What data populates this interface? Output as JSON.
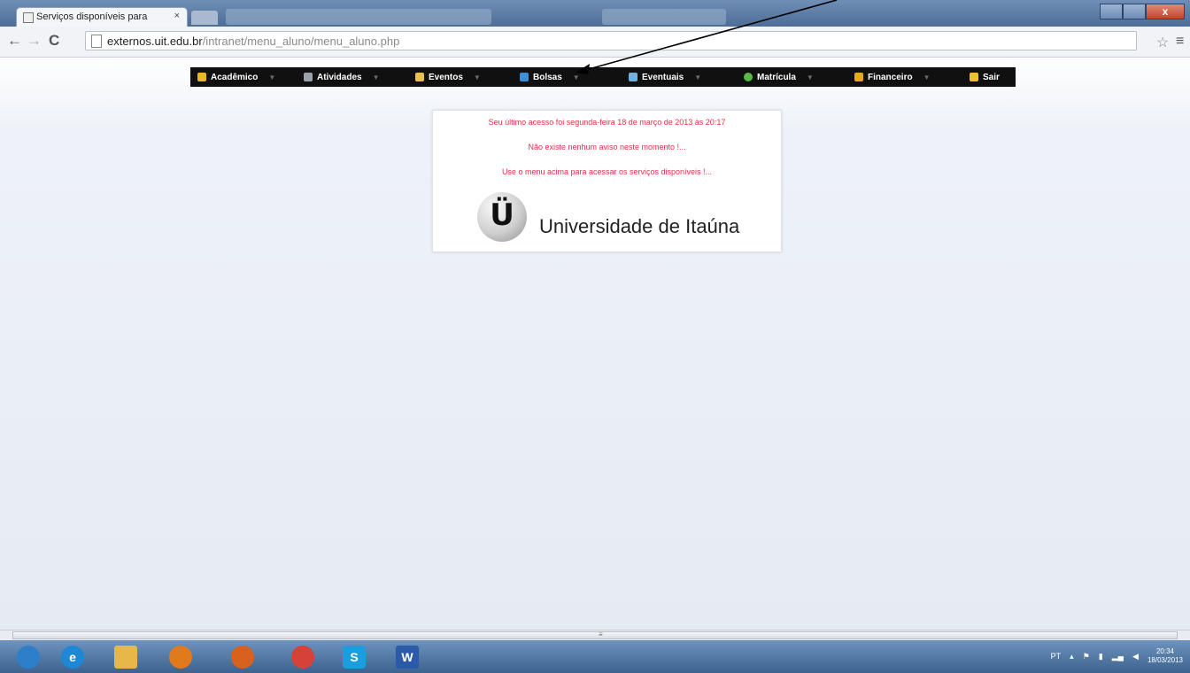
{
  "browser": {
    "tab_title": "Serviços disponíveis para",
    "tab_close": "×",
    "url_host": "externos.uit.edu.br",
    "url_path": "/intranet/menu_aluno/menu_aluno.php",
    "back": "←",
    "forward": "→",
    "reload": "C",
    "star": "☆",
    "menu": "≡",
    "close_window": "x"
  },
  "menu": {
    "items": [
      {
        "label": "Acadêmico",
        "color": "#f0b429"
      },
      {
        "label": "Atividades",
        "color": "#9aa3ad"
      },
      {
        "label": "Eventos",
        "color": "#e8c24a"
      },
      {
        "label": "Bolsas",
        "color": "#3c8fd8"
      },
      {
        "label": "Eventuais",
        "color": "#6fb1e0"
      },
      {
        "label": "Matrícula",
        "color": "#58b947"
      },
      {
        "label": "Financeiro",
        "color": "#e6a81e"
      },
      {
        "label": "Sair",
        "color": "#f0c030"
      }
    ],
    "arrow": "▼"
  },
  "notice": {
    "last_access": "Seu último acesso foi segunda-feira 18 de março de 2013 às 20:17",
    "no_notice": "Não existe nenhum aviso neste momento !...",
    "use_menu": "Use o menu acima para acessar os serviços disponíveis !...",
    "logo_mark": "Ü",
    "logo_text": "Universidade de Itaúna"
  },
  "taskbar": {
    "items": [
      {
        "icon": "start-orb",
        "label": "",
        "color": "#2d7fc9"
      },
      {
        "icon": "ie-icon",
        "label": "e",
        "color": "#1e88d6"
      },
      {
        "icon": "folder-icon",
        "label": "",
        "color": "#e5b84a"
      },
      {
        "icon": "media-player-icon",
        "label": "",
        "color": "#e07a1c"
      },
      {
        "icon": "firefox-icon",
        "label": "",
        "color": "#d9611f"
      },
      {
        "icon": "chrome-icon",
        "label": "",
        "color": "#d6413a"
      },
      {
        "icon": "skype-icon",
        "label": "S",
        "color": "#1a9ee0"
      },
      {
        "icon": "word-icon",
        "label": "W",
        "color": "#2a5aa8"
      }
    ],
    "lang": "PT",
    "time": "20:34",
    "date": "18/03/2013"
  }
}
